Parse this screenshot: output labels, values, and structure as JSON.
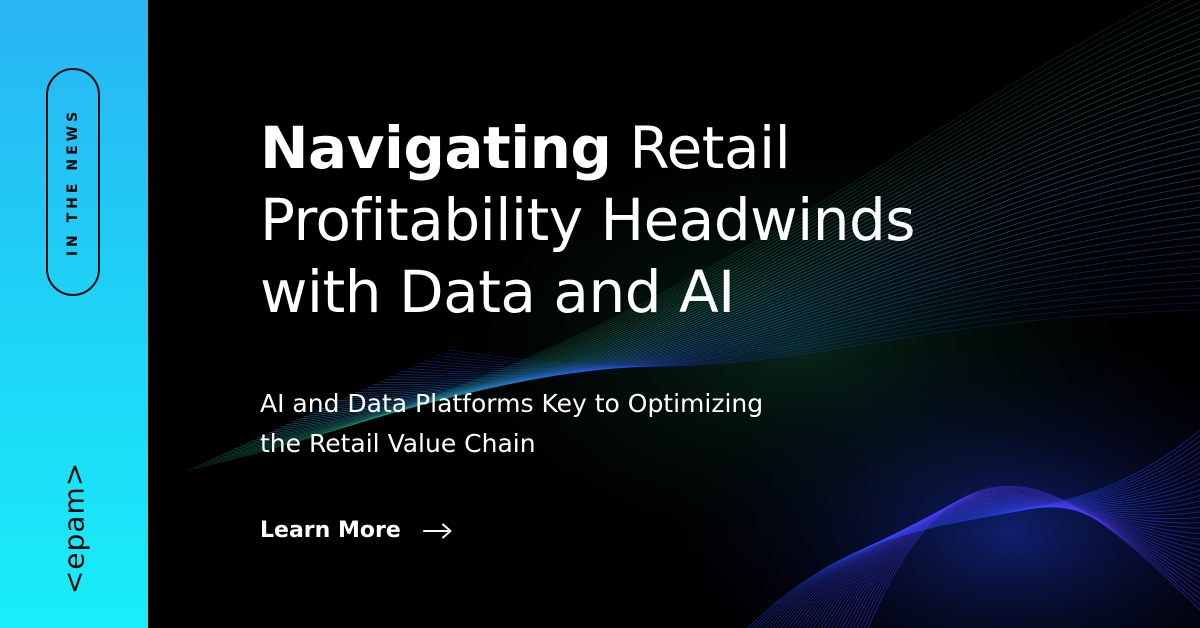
{
  "badge": {
    "label": "IN THE NEWS"
  },
  "brand": {
    "logo_text": "<epam>"
  },
  "headline": {
    "strong": "Navigating",
    "rest": " Retail Profitability Headwinds with Data and AI"
  },
  "subheadline": "AI and Data Platforms Key to Optimizing the Retail Value Chain",
  "cta": {
    "label": "Learn More",
    "icon": "arrow-right-icon"
  },
  "colors": {
    "strip_top": "#2ab4f3",
    "strip_bottom": "#18eef9",
    "background": "#000000",
    "text": "#ffffff",
    "wave_blue": "#2a4cff",
    "wave_green": "#1fa86a"
  }
}
